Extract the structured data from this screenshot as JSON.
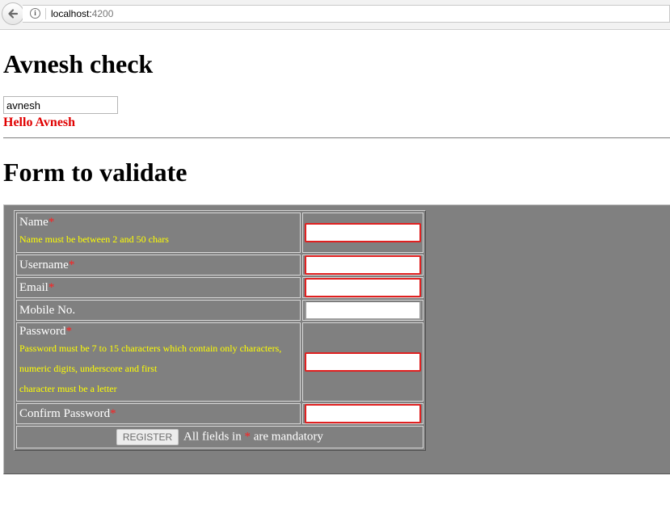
{
  "browser": {
    "url_host": "localhost:",
    "url_port": "4200"
  },
  "page": {
    "title": "Avnesh check",
    "name_input_value": "avnesh",
    "greeting": "Hello Avnesh",
    "form_title": "Form to validate"
  },
  "form": {
    "required_mark": "*",
    "name": {
      "label": "Name",
      "hint": "Name must be between 2 and 50 chars"
    },
    "username": {
      "label": "Username"
    },
    "email": {
      "label": "Email"
    },
    "mobile": {
      "label": "Mobile No."
    },
    "password": {
      "label": "Password",
      "hint_line1": "Password must be 7 to 15 characters which contain only characters,",
      "hint_line2": "numeric digits, underscore and first",
      "hint_line3": "character must be a letter"
    },
    "confirm_password": {
      "label": "Confirm Password"
    },
    "register_label": "REGISTER",
    "mandatory_prefix": "All fields in ",
    "mandatory_suffix": " are mandatory"
  },
  "colors": {
    "error_border": "#e02020",
    "hint_text": "#ffff00",
    "greeting": "#e00000",
    "panel_bg": "#808080"
  }
}
